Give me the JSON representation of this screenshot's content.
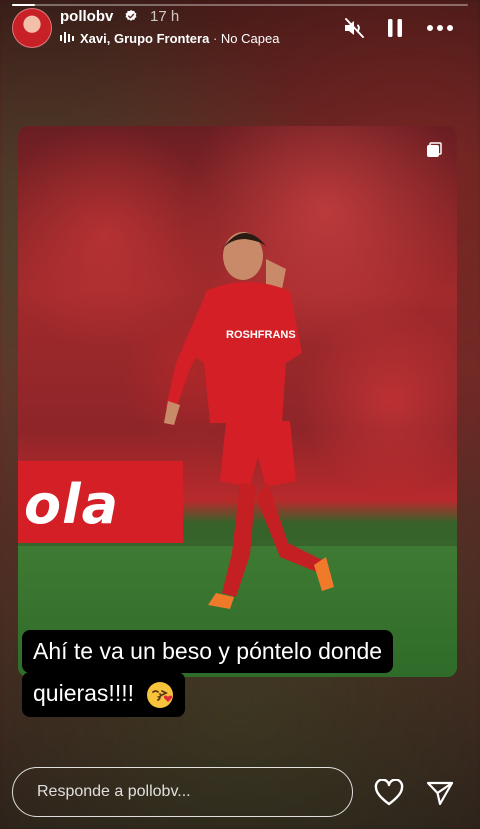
{
  "story": {
    "progress": 0.05
  },
  "header": {
    "username": "pollobv",
    "time": "17 h",
    "music": {
      "artist": "Xavi, Grupo Frontera",
      "separator": "·",
      "song": "No Capea"
    }
  },
  "photo": {
    "banner_text": "ola",
    "jersey_text": "ROSHFRANS"
  },
  "caption": {
    "line1": "Ahí te va un beso y póntelo donde",
    "line2": "quieras!!!!"
  },
  "reply": {
    "placeholder": "Responde a pollobv..."
  },
  "icons": {
    "verified": "verified-badge-icon",
    "music": "music-bars-icon",
    "mute": "muted-speaker-icon",
    "pause": "pause-icon",
    "more": "more-options-icon",
    "like": "heart-icon",
    "send": "send-icon",
    "carousel": "multiple-photos-icon",
    "emoji": "kissing-face-emoji"
  },
  "colors": {
    "jersey_red": "#d31f25",
    "pitch_green": "#3f7a34"
  }
}
